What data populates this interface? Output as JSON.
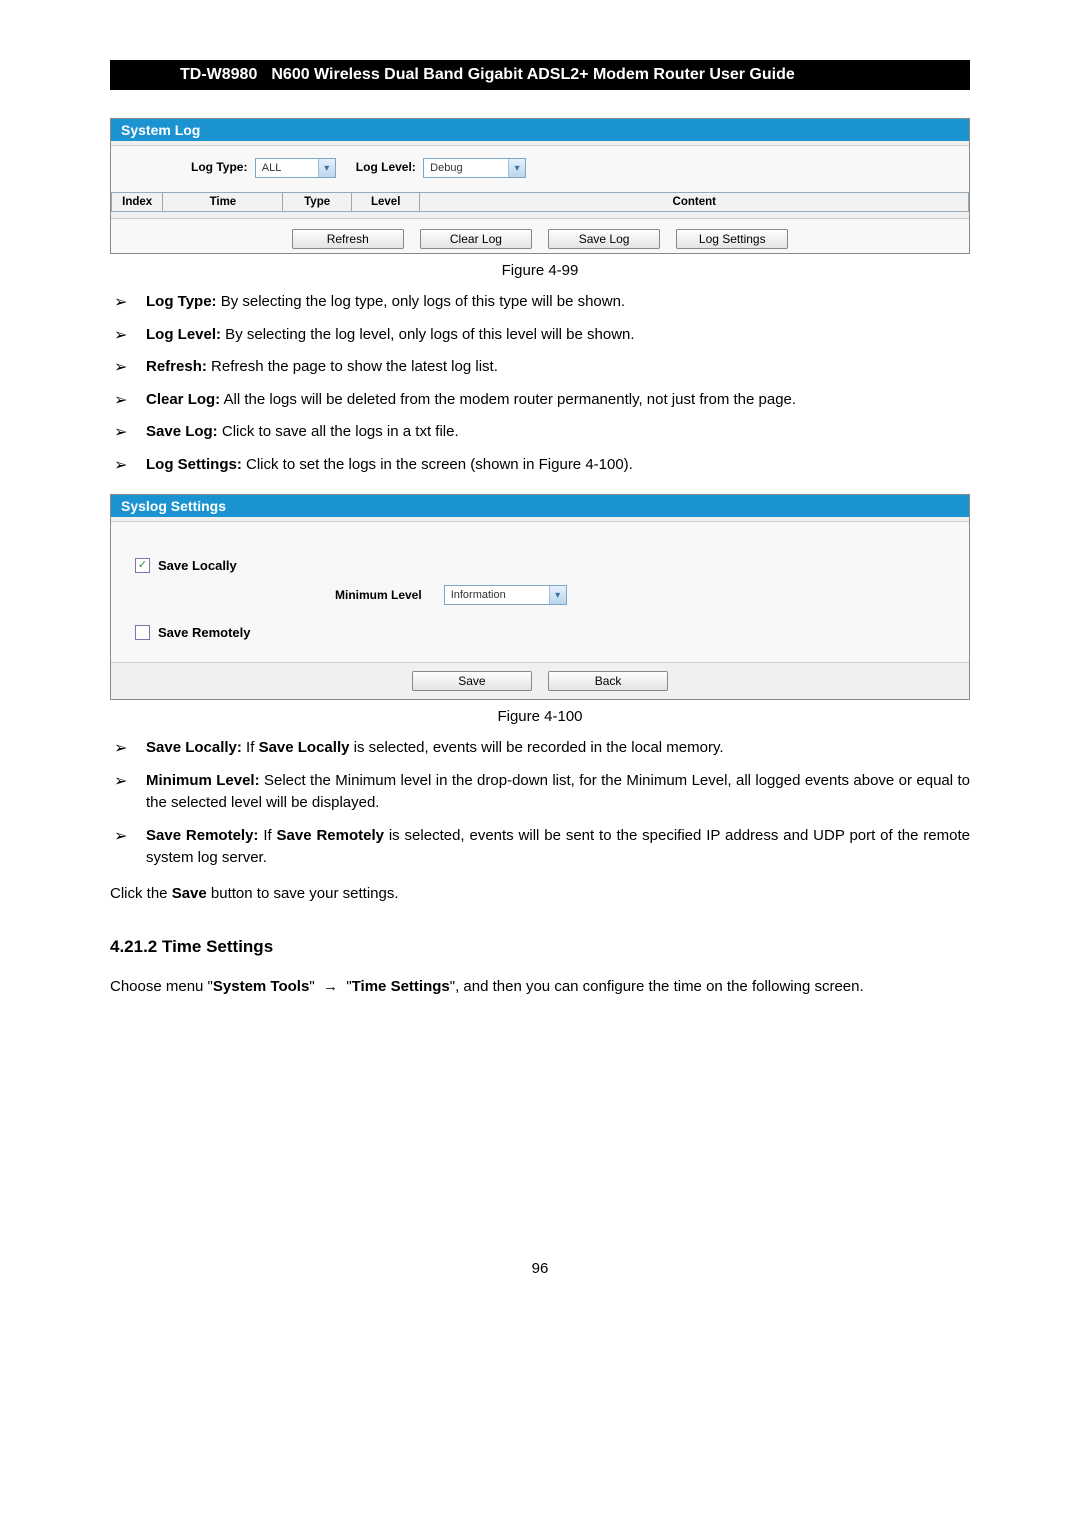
{
  "header": {
    "model": "TD-W8980",
    "desc": "N600 Wireless Dual Band Gigabit ADSL2+ Modem Router User Guide"
  },
  "syslog_panel": {
    "title": "System Log",
    "log_type_label": "Log Type:",
    "log_type_value": "ALL",
    "log_level_label": "Log Level:",
    "log_level_value": "Debug",
    "cols": {
      "index": "Index",
      "time": "Time",
      "type": "Type",
      "level": "Level",
      "content": "Content"
    },
    "buttons": {
      "refresh": "Refresh",
      "clear": "Clear Log",
      "save": "Save Log",
      "settings": "Log Settings"
    }
  },
  "captions": {
    "fig99": "Figure 4-99",
    "fig100": "Figure 4-100"
  },
  "list99": [
    {
      "label": "Log Type:",
      "text": " By selecting the log type, only logs of this type will be shown."
    },
    {
      "label": "Log Level:",
      "text": " By selecting the log level, only logs of this level will be shown."
    },
    {
      "label": "Refresh:",
      "text": " Refresh the page to show the latest log list."
    },
    {
      "label": "Clear Log:",
      "text": " All the logs will be deleted from the modem router permanently, not just from the page."
    },
    {
      "label": "Save Log:",
      "text": " Click to save all the logs in a txt file."
    },
    {
      "label": "Log Settings:",
      "text": " Click to set the logs in the screen (shown in Figure 4-100)."
    }
  ],
  "syslog_settings": {
    "title": "Syslog Settings",
    "save_locally": "Save Locally",
    "min_level_label": "Minimum Level",
    "min_level_value": "Information",
    "save_remotely": "Save Remotely",
    "buttons": {
      "save": "Save",
      "back": "Back"
    }
  },
  "list100": {
    "i1": {
      "label": "Save Locally:",
      "pre": " If ",
      "bold1": "Save Locally",
      "post": " is selected, events will be recorded in the local memory."
    },
    "i2": {
      "label": "Minimum Level:",
      "text": " Select the Minimum level in the drop-down list, for the Minimum Level, all logged events above or equal to the selected level will be displayed."
    },
    "i3": {
      "label": "Save Remotely:",
      "pre": " If ",
      "bold1": "Save Remotely",
      "post": " is selected, events will be sent to the specified IP address and UDP port of the remote system log server."
    }
  },
  "save_line": {
    "pre": "Click the ",
    "bold": "Save",
    "post": " button to save your settings."
  },
  "section_title": "4.21.2 Time Settings",
  "nav_line": {
    "pre": "Choose menu \"",
    "system_tools": "System Tools",
    "arrow": "→",
    "time_settings": "Time Settings",
    "post": "\", and then you can configure the time on the following screen."
  },
  "page_no": "96"
}
